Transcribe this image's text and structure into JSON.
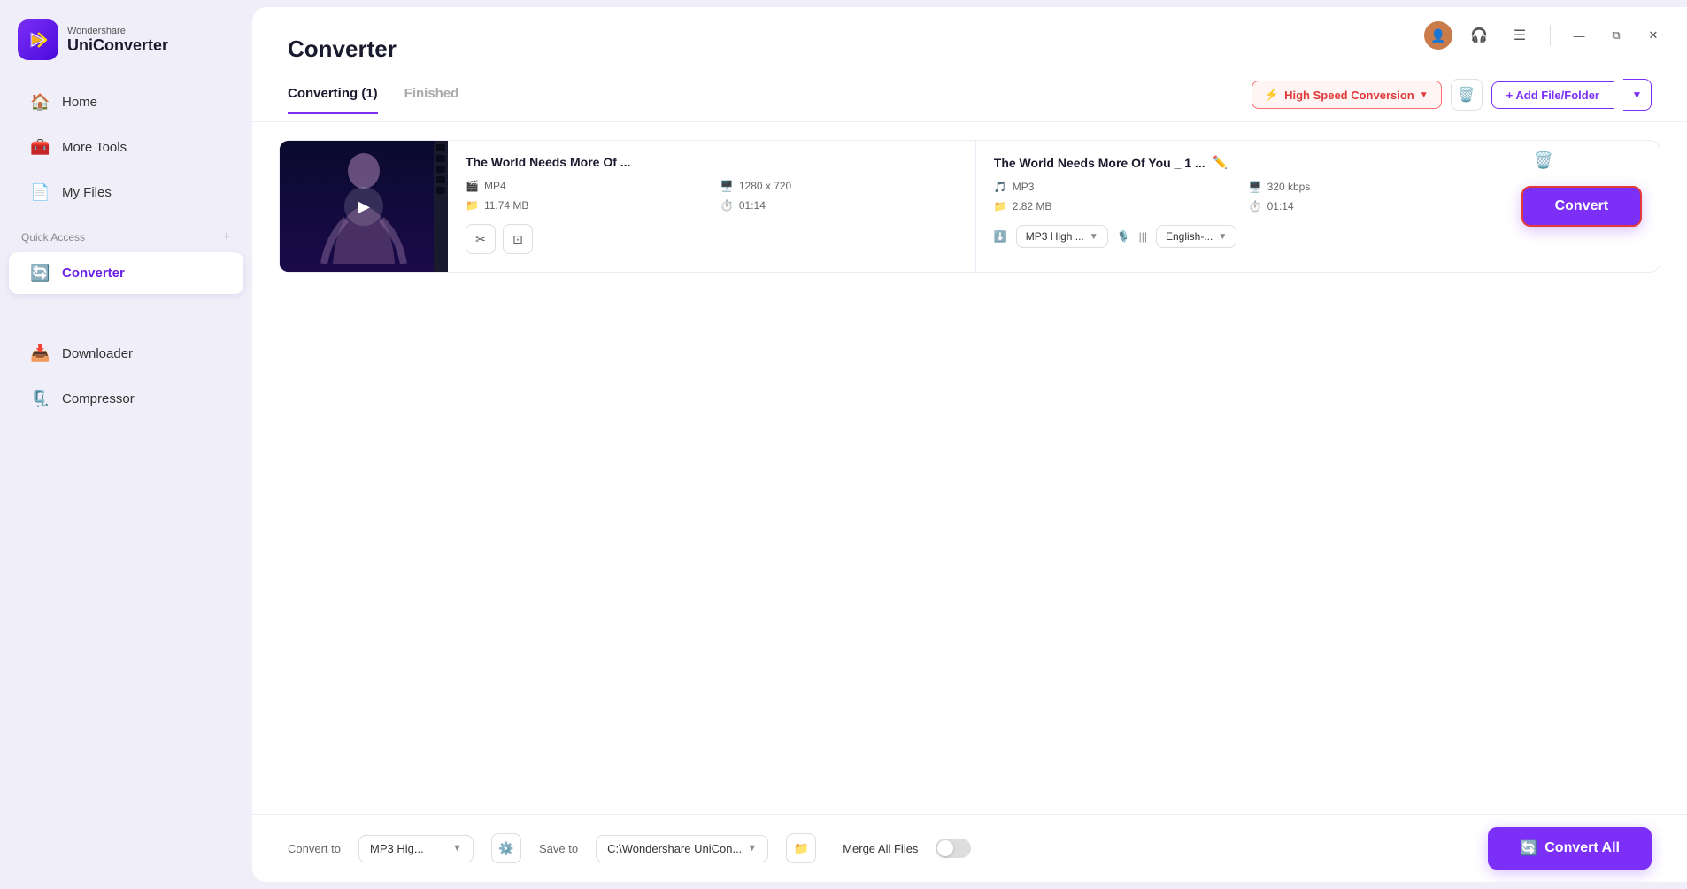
{
  "app": {
    "brand": "Wondershare",
    "name": "UniConverter"
  },
  "sidebar": {
    "nav_items": [
      {
        "id": "home",
        "label": "Home",
        "icon": "🏠",
        "active": false
      },
      {
        "id": "more-tools",
        "label": "More Tools",
        "icon": "🧰",
        "active": false
      },
      {
        "id": "my-files",
        "label": "My Files",
        "icon": "📄",
        "active": false
      }
    ],
    "section_label": "Quick Access",
    "converter": {
      "label": "Converter",
      "active": true
    }
  },
  "sidebar_bottom": {
    "downloader": {
      "label": "Downloader",
      "icon": "📥"
    },
    "compressor": {
      "label": "Compressor",
      "icon": "🗜️"
    }
  },
  "main": {
    "title": "Converter",
    "tabs": [
      {
        "id": "converting",
        "label": "Converting (1)",
        "active": true
      },
      {
        "id": "finished",
        "label": "Finished",
        "active": false
      }
    ],
    "toolbar": {
      "high_speed": "High Speed Conversion",
      "add_file": "+ Add File/Folder"
    }
  },
  "file_item": {
    "source": {
      "name": "The World Needs More Of ...",
      "format": "MP4",
      "resolution": "1280 x 720",
      "size": "11.74 MB",
      "duration": "01:14"
    },
    "output": {
      "name": "The World Needs More Of You _ 1 ...",
      "format": "MP3",
      "bitrate": "320 kbps",
      "size": "2.82 MB",
      "duration": "01:14",
      "quality": "MP3 High ...",
      "subtitle": "English-..."
    },
    "convert_btn_label": "Convert"
  },
  "bottom_bar": {
    "convert_to_label": "Convert to",
    "format_value": "MP3 Hig...",
    "save_to_label": "Save to",
    "save_path": "C:\\Wondershare UniCon...",
    "merge_label": "Merge All Files",
    "convert_all_label": "Convert All"
  },
  "window_controls": {
    "minimize": "—",
    "maximize": "⧉",
    "close": "✕"
  }
}
